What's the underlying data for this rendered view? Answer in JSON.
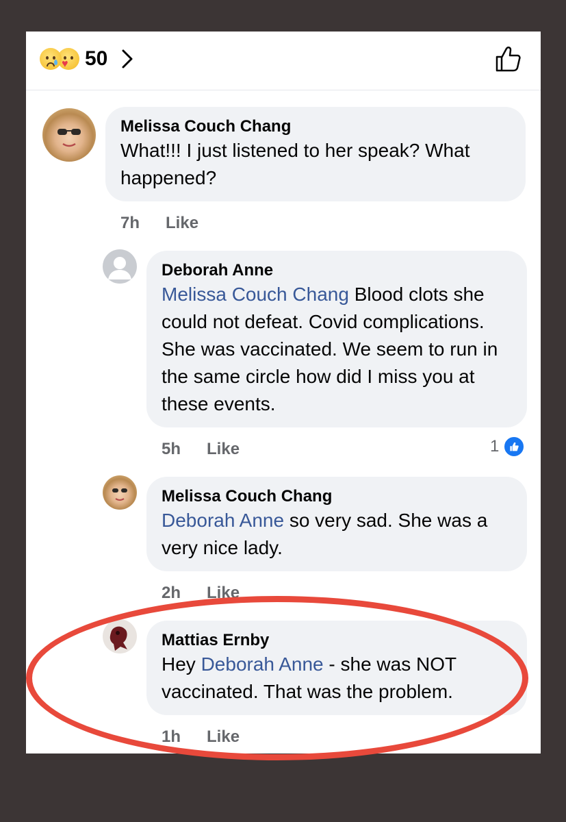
{
  "header": {
    "reaction_icons": [
      "sad-icon",
      "care-icon"
    ],
    "reaction_count": "50"
  },
  "comments": [
    {
      "author": "Melissa Couch Chang",
      "text": "What!!! I just listened to her speak? What happened?",
      "time": "7h",
      "like_label": "Like"
    },
    {
      "author": "Deborah Anne",
      "mention": "Melissa Couch Chang",
      "text": " Blood clots she could not defeat.  Covid complications.  She was vaccinated. We seem to run in the same circle how did I miss you at these events.",
      "time": "5h",
      "like_label": "Like",
      "reaction_count": "1"
    },
    {
      "author": "Melissa Couch Chang",
      "mention": "Deborah Anne",
      "text": " so very sad. She was a very nice lady.",
      "time": "2h",
      "like_label": "Like"
    },
    {
      "author": "Mattias Ernby",
      "prefix": "Hey ",
      "mention": "Deborah Anne",
      "text": " - she was NOT vaccinated. That was the problem.",
      "time": "1h",
      "like_label": "Like"
    }
  ],
  "colors": {
    "background": "#3c3535",
    "bubble": "#f0f2f5",
    "mention": "#385898",
    "highlight_circle": "#e8493b",
    "like_blue": "#1877f2"
  }
}
